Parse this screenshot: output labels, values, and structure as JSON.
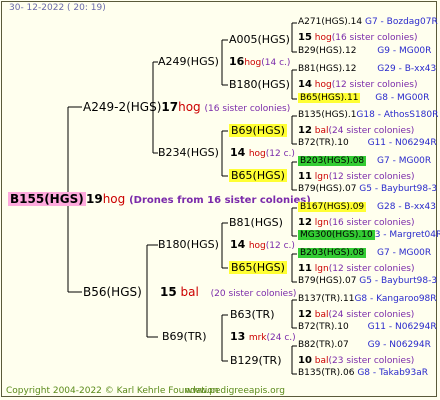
{
  "date": "30- 12-2022 ( 20: 19)",
  "footer": {
    "copyright": "Copyright 2004-2022 © Karl Kehrle Foundation",
    "site": "www.pedigreeapis.org"
  },
  "root": {
    "id": "B155(HGS)",
    "count": "19",
    "hog": "hog",
    "note": "(Drones from 16 sister colonies)"
  },
  "l1": [
    {
      "id": "A249-2(HGS)",
      "count": "17",
      "hog": "hog",
      "note": "(16 sister colonies)"
    },
    {
      "id": "B56(HGS)",
      "count": "15",
      "hog": "bal",
      "note": "(20 sister colonies)"
    }
  ],
  "l2": [
    {
      "id": "A249(HGS)",
      "count": "16",
      "hog": "hog",
      "note": "(14 c.)"
    },
    {
      "id": "B234(HGS)",
      "count": "14",
      "hog": "hog",
      "note": "(12 c.)"
    },
    {
      "id": "B180(HGS)",
      "count": "14",
      "hog": "hog",
      "note": "(12 c.)"
    },
    {
      "id": "B69(TR)",
      "count": "13",
      "hog": "mrk",
      "note": "(24 c.)"
    }
  ],
  "l3": [
    "A005(HGS)",
    "B180(HGS)",
    "B69(HGS)",
    "B65(HGS)",
    "B81(HGS)",
    "B65(HGS)",
    "B63(TR)",
    "B129(TR)"
  ],
  "l4": [
    {
      "top": "A271(HGS).14",
      "top_blue": "G7 - Bozdag07R",
      "mid_num": "15",
      "mid_race": "hog",
      "mid_note": "(16 sister colonies)",
      "bot": "B29(HGS).12",
      "bot_blue": "G9 - MG00R"
    },
    {
      "top": "B81(HGS).12",
      "top_blue": "G29 - B-xx43",
      "mid_num": "14",
      "mid_race": "hog",
      "mid_note": "(12 sister colonies)",
      "bot": "B65(HGS).11",
      "bot_blue": "G8 - MG00R"
    },
    {
      "top": "B135(HGS).1",
      "top_blue": "G18 - AthosS180R",
      "mid_num": "12",
      "mid_race": "bal",
      "mid_note": "(24 sister colonies)",
      "bot": "B72(TR).10",
      "bot_blue": "G11 - N06294R"
    },
    {
      "top": "B203(HGS).08",
      "top_blue": "G7 - MG00R",
      "mid_num": "11",
      "mid_race": "lgn",
      "mid_note": "(12 sister colonies)",
      "bot": "B79(HGS).07",
      "bot_blue": "G5 - Bayburt98-3"
    },
    {
      "top": "B167(HGS).09",
      "top_blue": "G28 - B-xx43",
      "mid_num": "12",
      "mid_race": "lgn",
      "mid_note": "(16 sister colonies)",
      "bot": "MG300(HGS).10",
      "bot_blue": "3 - Margret04R"
    },
    {
      "top": "B203(HGS).08",
      "top_blue": "G7 - MG00R",
      "mid_num": "11",
      "mid_race": "lgn",
      "mid_note": "(12 sister colonies)",
      "bot": "B79(HGS).07",
      "bot_blue": "G5 - Bayburt98-3"
    },
    {
      "top": "B137(TR).11",
      "top_blue": "G8 - Kangaroo98R",
      "mid_num": "12",
      "mid_race": "bal",
      "mid_note": "(24 sister colonies)",
      "bot": "B72(TR).10",
      "bot_blue": "G11 - N06294R"
    },
    {
      "top": "B82(TR).07",
      "top_blue": "G9 - N06294R",
      "mid_num": "10",
      "mid_race": "bal",
      "mid_note": "(23 sister colonies)",
      "bot": "B135(TR).06",
      "bot_blue": "G8 - Takab93aR"
    }
  ]
}
